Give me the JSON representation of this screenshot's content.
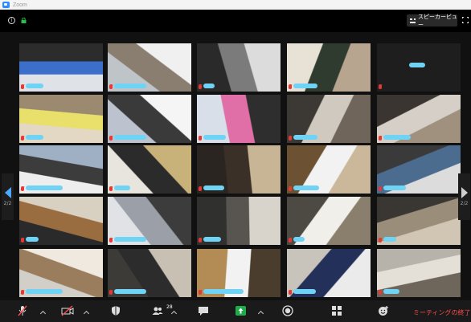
{
  "window": {
    "title": "Zoom"
  },
  "topbar": {
    "speaker_view_label": "スピーカービュー"
  },
  "pagination": {
    "left_page": "2/2",
    "right_page": "2/2"
  },
  "toolbar": {
    "participants_count": "28",
    "end_meeting_label": "ミーティングの終了"
  },
  "colors": {
    "accent": "#2d8cff",
    "share_green": "#1fad4a",
    "end_red": "#ff4c4c",
    "name_tag": "#6fd3f5",
    "muted_red": "#e53935"
  },
  "icons": [
    "info-icon",
    "lock-icon",
    "grid-view-icon",
    "fullscreen-icon",
    "mic-muted-icon",
    "video-off-icon",
    "security-icon",
    "participants-icon",
    "chat-icon",
    "share-screen-icon",
    "record-icon",
    "breakout-icon",
    "reactions-icon"
  ]
}
